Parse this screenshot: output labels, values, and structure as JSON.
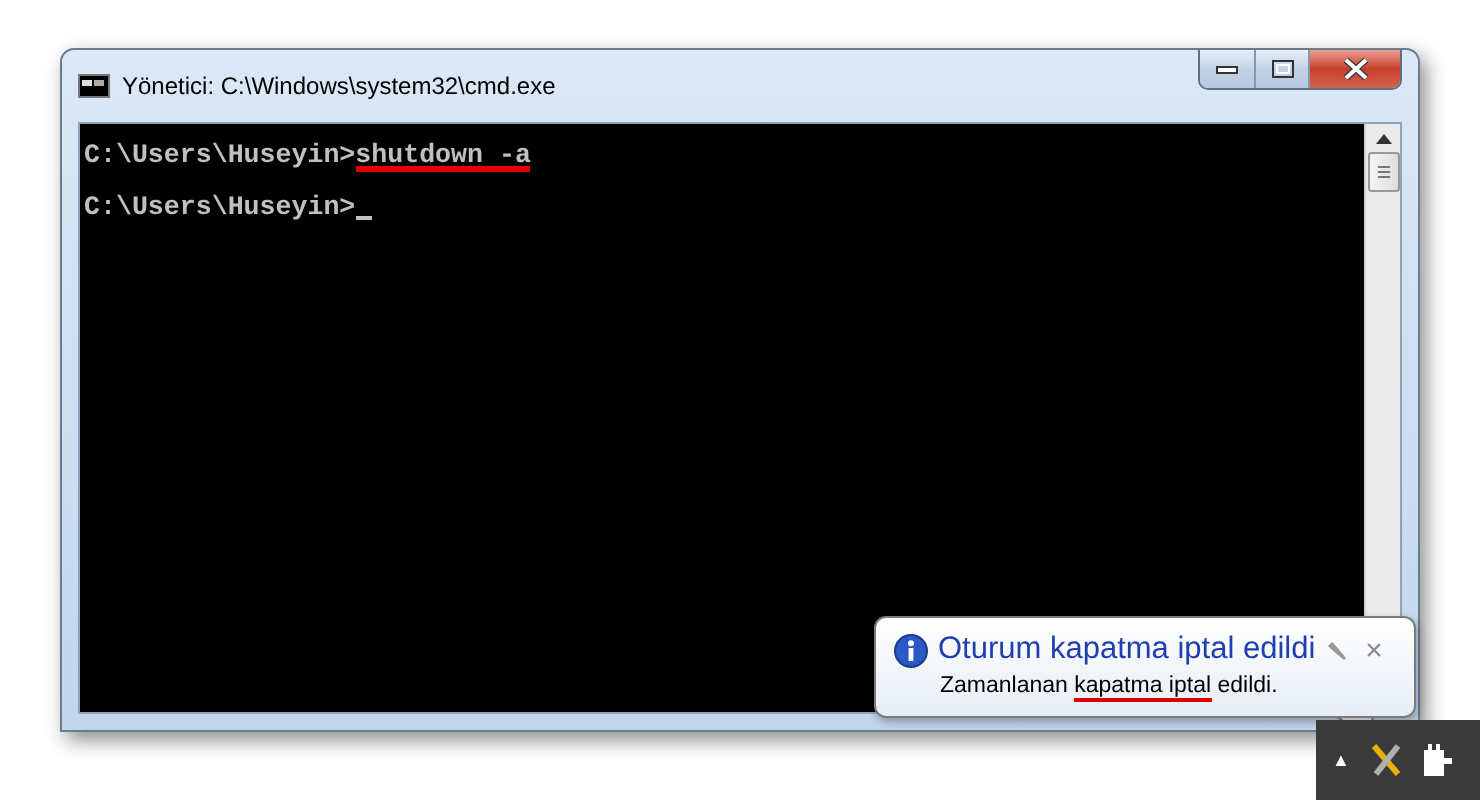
{
  "window": {
    "title": "Yönetici: C:\\Windows\\system32\\cmd.exe"
  },
  "console": {
    "lines": [
      {
        "prompt": "C:\\Users\\Huseyin>",
        "command": "shutdown -a",
        "underlined": true
      },
      {
        "prompt": "C:\\Users\\Huseyin>",
        "cursor": true
      }
    ]
  },
  "balloon": {
    "title": "Oturum kapatma iptal edildi",
    "close": "×",
    "body": [
      {
        "text": "Zamanlanan ",
        "underlined": false
      },
      {
        "text": "kapatma iptal",
        "underlined": true
      },
      {
        "text": " edildi.",
        "underlined": false
      }
    ]
  },
  "tray": {
    "expand": "▲"
  }
}
